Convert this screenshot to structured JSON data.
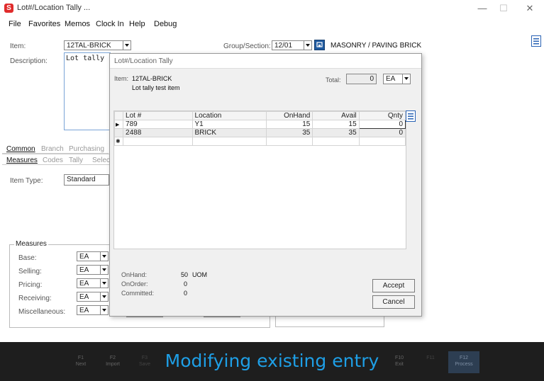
{
  "window": {
    "app_icon": "S",
    "title": "Lot#/Location Tally ...",
    "minimize": "—",
    "maximize": "☐",
    "close": "✕"
  },
  "menu": [
    "File",
    "Favorites",
    "Memos",
    "Clock In",
    "Help",
    "Debug"
  ],
  "form": {
    "item_label": "Item:",
    "item_value": "12TAL-BRICK",
    "group_label": "Group/Section:",
    "group_value": "12/01",
    "group_name": "MASONRY / PAVING BRICK",
    "desc_label": "Description:",
    "desc_value": "Lot tally",
    "tabs_row1": [
      "Common",
      "Branch",
      "Purchasing"
    ],
    "tabs_row2": [
      "Measures",
      "Codes",
      "Tally",
      "Select"
    ],
    "item_type_label": "Item Type:",
    "item_type_value": "Standard",
    "measures_group": "Measures",
    "measures": [
      {
        "label": "Base:",
        "value": "EA"
      },
      {
        "label": "Selling:",
        "value": "EA"
      },
      {
        "label": "Pricing:",
        "value": "EA"
      },
      {
        "label": "Receiving:",
        "value": "EA"
      },
      {
        "label": "Miscellaneous:",
        "value": "EA"
      }
    ]
  },
  "dialog": {
    "title": "Lot#/Location Tally",
    "item_label": "Item:",
    "item_code": "12TAL-BRICK",
    "item_desc": "Lot tally test item",
    "total_label": "Total:",
    "total_value": "0",
    "uom_value": "EA",
    "columns": [
      "Lot #",
      "Location",
      "OnHand",
      "Avail",
      "Qnty"
    ],
    "rows": [
      {
        "lot": "789",
        "location": "Y1",
        "onhand": "15",
        "avail": "15",
        "qnty": "0"
      },
      {
        "lot": "2488",
        "location": "BRICK",
        "onhand": "35",
        "avail": "35",
        "qnty": "0"
      }
    ],
    "onhand_label": "OnHand:",
    "onhand_value": "50",
    "onhand_uom": "UOM",
    "onorder_label": "OnOrder:",
    "onorder_value": "0",
    "committed_label": "Committed:",
    "committed_value": "0",
    "accept": "Accept",
    "cancel": "Cancel"
  },
  "fkeys": [
    {
      "key": "F1",
      "label": "Next"
    },
    {
      "key": "F2",
      "label": "Import"
    },
    {
      "key": "F3",
      "label": "Save"
    },
    {
      "key": "F10",
      "label": "Exit"
    },
    {
      "key": "F11",
      "label": ""
    },
    {
      "key": "F12",
      "label": "Process"
    }
  ],
  "caption": "Modifying existing entry",
  "colors": {
    "caption": "#1e9fe6",
    "bottom_bar": "#1e1e1e",
    "accent_button": "#1f5aa0"
  }
}
